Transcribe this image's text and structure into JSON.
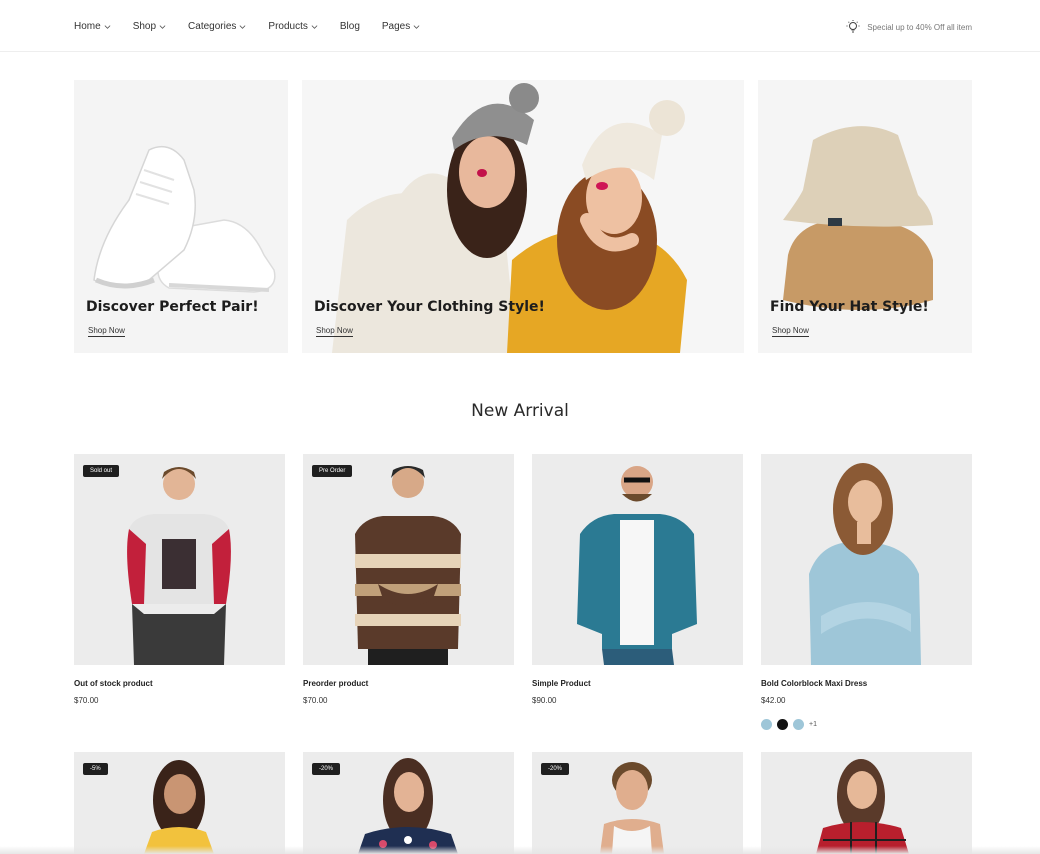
{
  "nav": {
    "items": [
      {
        "label": "Home",
        "has_dropdown": true
      },
      {
        "label": "Shop",
        "has_dropdown": true
      },
      {
        "label": "Categories",
        "has_dropdown": true
      },
      {
        "label": "Products",
        "has_dropdown": true
      },
      {
        "label": "Blog",
        "has_dropdown": false
      },
      {
        "label": "Pages",
        "has_dropdown": true
      }
    ],
    "promo_icon": "lightbulb-icon",
    "promo_text": "Special up to 40% Off all item"
  },
  "banners": [
    {
      "title": "Discover Perfect Pair!",
      "link": "Shop Now"
    },
    {
      "title": "Discover Your Clothing Style!",
      "link": "Shop Now"
    },
    {
      "title": "Find Your Hat Style!",
      "link": "Shop Now"
    }
  ],
  "section": {
    "title": "New Arrival"
  },
  "products": [
    {
      "badge": "Sold out",
      "name": "Out of stock product",
      "price": "$70.00"
    },
    {
      "badge": "Pre Order",
      "name": "Preorder product",
      "price": "$70.00"
    },
    {
      "badge": "",
      "name": "Simple Product",
      "price": "$90.00"
    },
    {
      "badge": "",
      "name": "Bold Colorblock Maxi Dress",
      "price": "$42.00",
      "swatches": [
        "#9ec6d8",
        "#111111",
        "#9ec6d8"
      ],
      "more_swatches": "+1"
    }
  ],
  "products_row2": [
    {
      "badge": "-5%"
    },
    {
      "badge": "-20%"
    },
    {
      "badge": "-20%"
    },
    {
      "badge": ""
    }
  ],
  "colors": {
    "accent_dark": "#1f1f1f",
    "card_bg": "#ececec"
  }
}
